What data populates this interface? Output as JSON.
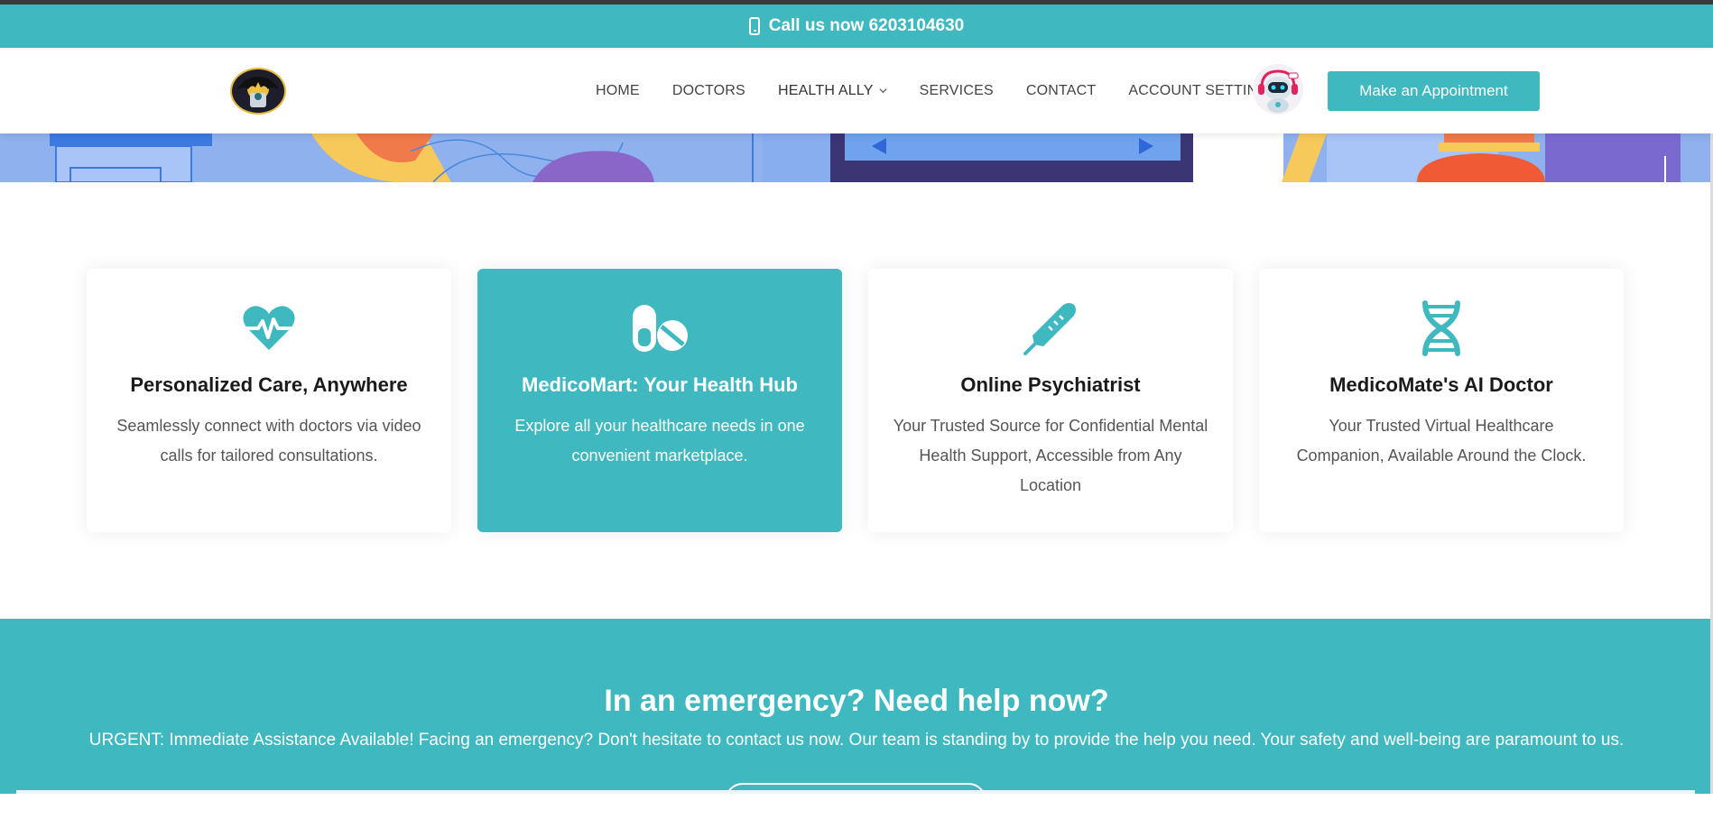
{
  "topbar": {
    "call_text": "Call us now 6203104630",
    "icon": "mobile-phone-icon"
  },
  "navbar": {
    "logo_icon": "batman-logo-icon",
    "links": [
      {
        "label": "HOME"
      },
      {
        "label": "DOCTORS"
      },
      {
        "label": "HEALTH ALLY",
        "dropdown": true
      },
      {
        "label": "SERVICES"
      },
      {
        "label": "CONTACT"
      },
      {
        "label": "ACCOUNT SETTINGS",
        "dropdown": true
      }
    ],
    "assistant_icon": "robot-assistant-icon",
    "cta_label": "Make an Appointment"
  },
  "services": [
    {
      "icon": "heartbeat-icon",
      "title": "Personalized Care, Anywhere",
      "text": "Seamlessly connect with doctors via video calls for tailored consultations."
    },
    {
      "icon": "pills-icon",
      "title": "MedicoMart: Your Health Hub",
      "text": "Explore all your healthcare needs in one convenient marketplace.",
      "featured": true
    },
    {
      "icon": "thermometer-icon",
      "title": "Online Psychiatrist",
      "text": "Your Trusted Source for Confidential Mental Health Support, Accessible from Any Location"
    },
    {
      "icon": "dna-icon",
      "title": "MedicoMate's AI Doctor",
      "text": "Your Trusted Virtual Healthcare Companion, Available Around the Clock."
    }
  ],
  "emergency": {
    "title": "In an emergency? Need help now?",
    "text": "URGENT: Immediate Assistance Available! Facing an emergency? Don't hesitate to contact us now. Our team is standing by to provide the help you need. Your safety and well-being are paramount to us."
  },
  "colors": {
    "primary": "#3fb9bf",
    "text_dark": "#1a1a1a",
    "text_muted": "#555555"
  }
}
